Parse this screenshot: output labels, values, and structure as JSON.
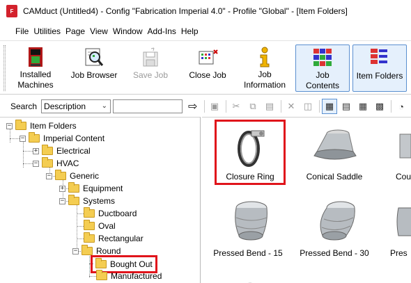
{
  "window": {
    "title": "CAMduct (Untitled4) - Config \"Fabrication Imperial 4.0\" - Profile \"Global\" - [Item Folders]",
    "app_badge": "F"
  },
  "menu": [
    "File",
    "Utilities",
    "Page",
    "View",
    "Window",
    "Add-Ins",
    "Help"
  ],
  "toolbar": {
    "installed_machines": "Installed\nMachines",
    "job_browser": "Job Browser",
    "save_job": "Save Job",
    "close_job": "Close Job",
    "job_information": "Job\nInformation",
    "job_contents": "Job\nContents",
    "item_folders": "Item Folders"
  },
  "search": {
    "label": "Search",
    "field": "Description",
    "query": ""
  },
  "tree": {
    "item_folders": "Item Folders",
    "imperial_content": "Imperial Content",
    "electrical": "Electrical",
    "hvac": "HVAC",
    "generic": "Generic",
    "equipment": "Equipment",
    "systems": "Systems",
    "ductboard": "Ductboard",
    "oval": "Oval",
    "rectangular": "Rectangular",
    "round": "Round",
    "bought_out": "Bought Out",
    "manufactured": "Manufactured"
  },
  "items": {
    "closure_ring": "Closure Ring",
    "conical_saddle": "Conical Saddle",
    "cou_partial": "Cou",
    "pressed_bend_15": "Pressed Bend - 15",
    "pressed_bend_30": "Pressed Bend - 30",
    "pres_partial": "Pres"
  },
  "colors": {
    "highlight": "#e0141b",
    "active_bg": "#e5f0fc",
    "active_border": "#5a8fd0"
  }
}
